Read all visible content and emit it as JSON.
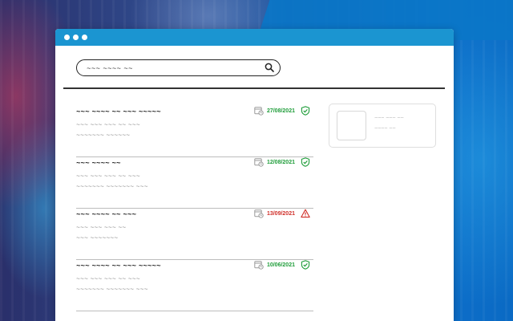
{
  "search": {
    "value": "~~~ ~~~~ ~~"
  },
  "results": [
    {
      "title": "~~~ ~~~~ ~~ ~~~ ~~~~~",
      "line1": "~~~ ~~~ ~~~ ~~ ~~~",
      "line2": "~~~~~~~ ~~~~~~",
      "date": "27/08/2021",
      "status": "ok",
      "date_color": "#1f9d3a"
    },
    {
      "title": "~~~ ~~~~ ~~",
      "line1": "~~~ ~~~ ~~~ ~~ ~~~",
      "line2": "~~~~~~~ ~~~~~~~ ~~~",
      "date": "12/08/2021",
      "status": "ok",
      "date_color": "#1f9d3a"
    },
    {
      "title": "~~~ ~~~~ ~~ ~~~",
      "line1": "~~~ ~~~ ~~~ ~~",
      "line2": "~~~ ~~~~~~~",
      "date": "13/09/2021",
      "status": "warn",
      "date_color": "#d0302a"
    },
    {
      "title": "~~~ ~~~~ ~~ ~~~ ~~~~~",
      "line1": "~~~ ~~~ ~~~ ~~ ~~~",
      "line2": "~~~~~~~ ~~~~~~~ ~~~",
      "date": "10/06/2021",
      "status": "ok",
      "date_color": "#1f9d3a"
    }
  ],
  "side_card": {
    "line1": "~~~ ~~~ ~~",
    "line2": "~~~~ ~~"
  },
  "icons": {
    "search": "search-icon",
    "calendar": "calendar-clock-icon",
    "ok": "shield-check-icon",
    "warn": "warning-triangle-icon"
  },
  "colors": {
    "titlebar": "#1b95d1",
    "ok": "#1f9d3a",
    "warn": "#d0302a"
  }
}
